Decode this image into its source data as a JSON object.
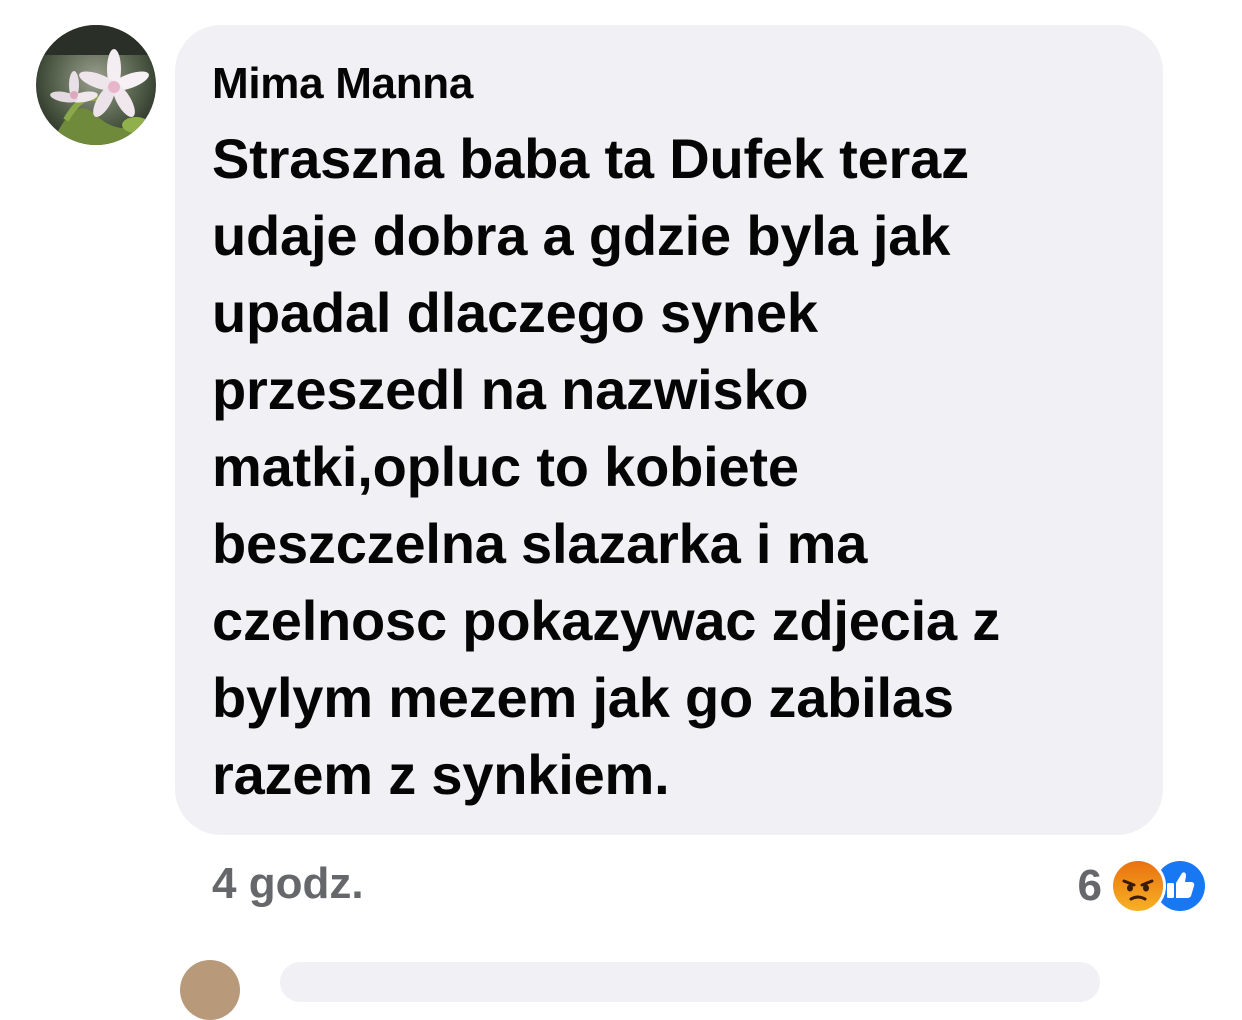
{
  "comment": {
    "author": "Mima Manna",
    "avatar_icon": "lily-flower-avatar",
    "text_lines": [
      "Straszna baba ta Dufek teraz",
      "udaje dobra a gdzie byla jak",
      "upadal dlaczego synek",
      "przeszedl na nazwisko",
      "matki,opluc to kobiete",
      "beszczelna slazarka i ma",
      "czelnosc pokazywac zdjecia z",
      "bylym mezem jak go zabilas",
      "razem z synkiem."
    ],
    "timestamp": "4 godz.",
    "reactions": {
      "count": "6",
      "icons": [
        "angry-reaction-icon",
        "like-reaction-icon"
      ]
    }
  },
  "colors": {
    "bubble_bg": "#f0f0f5",
    "text": "#050505",
    "meta_text": "#65676b",
    "like_blue": "#1877f2",
    "angry_top": "#e9710f",
    "angry_bottom": "#f7b125"
  }
}
